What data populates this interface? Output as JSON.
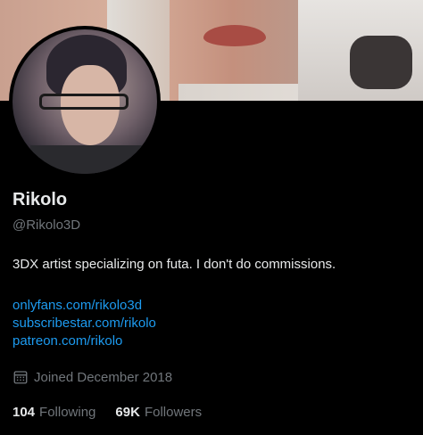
{
  "profile": {
    "name": "Rikolo",
    "handle": "@Rikolo3D",
    "bio": "3DX artist specializing on futa. I don't do commissions.",
    "links": [
      "onlyfans.com/rikolo3d",
      "subscribestar.com/rikolo",
      "patreon.com/rikolo"
    ],
    "joined": "Joined December 2018",
    "following_count": "104",
    "following_label": "Following",
    "followers_count": "69K",
    "followers_label": "Followers"
  },
  "colors": {
    "background": "#000000",
    "primary_text": "#e7e9ea",
    "secondary_text": "#71767b",
    "link": "#1d9bf0"
  },
  "icons": {
    "joined": "calendar-icon"
  }
}
